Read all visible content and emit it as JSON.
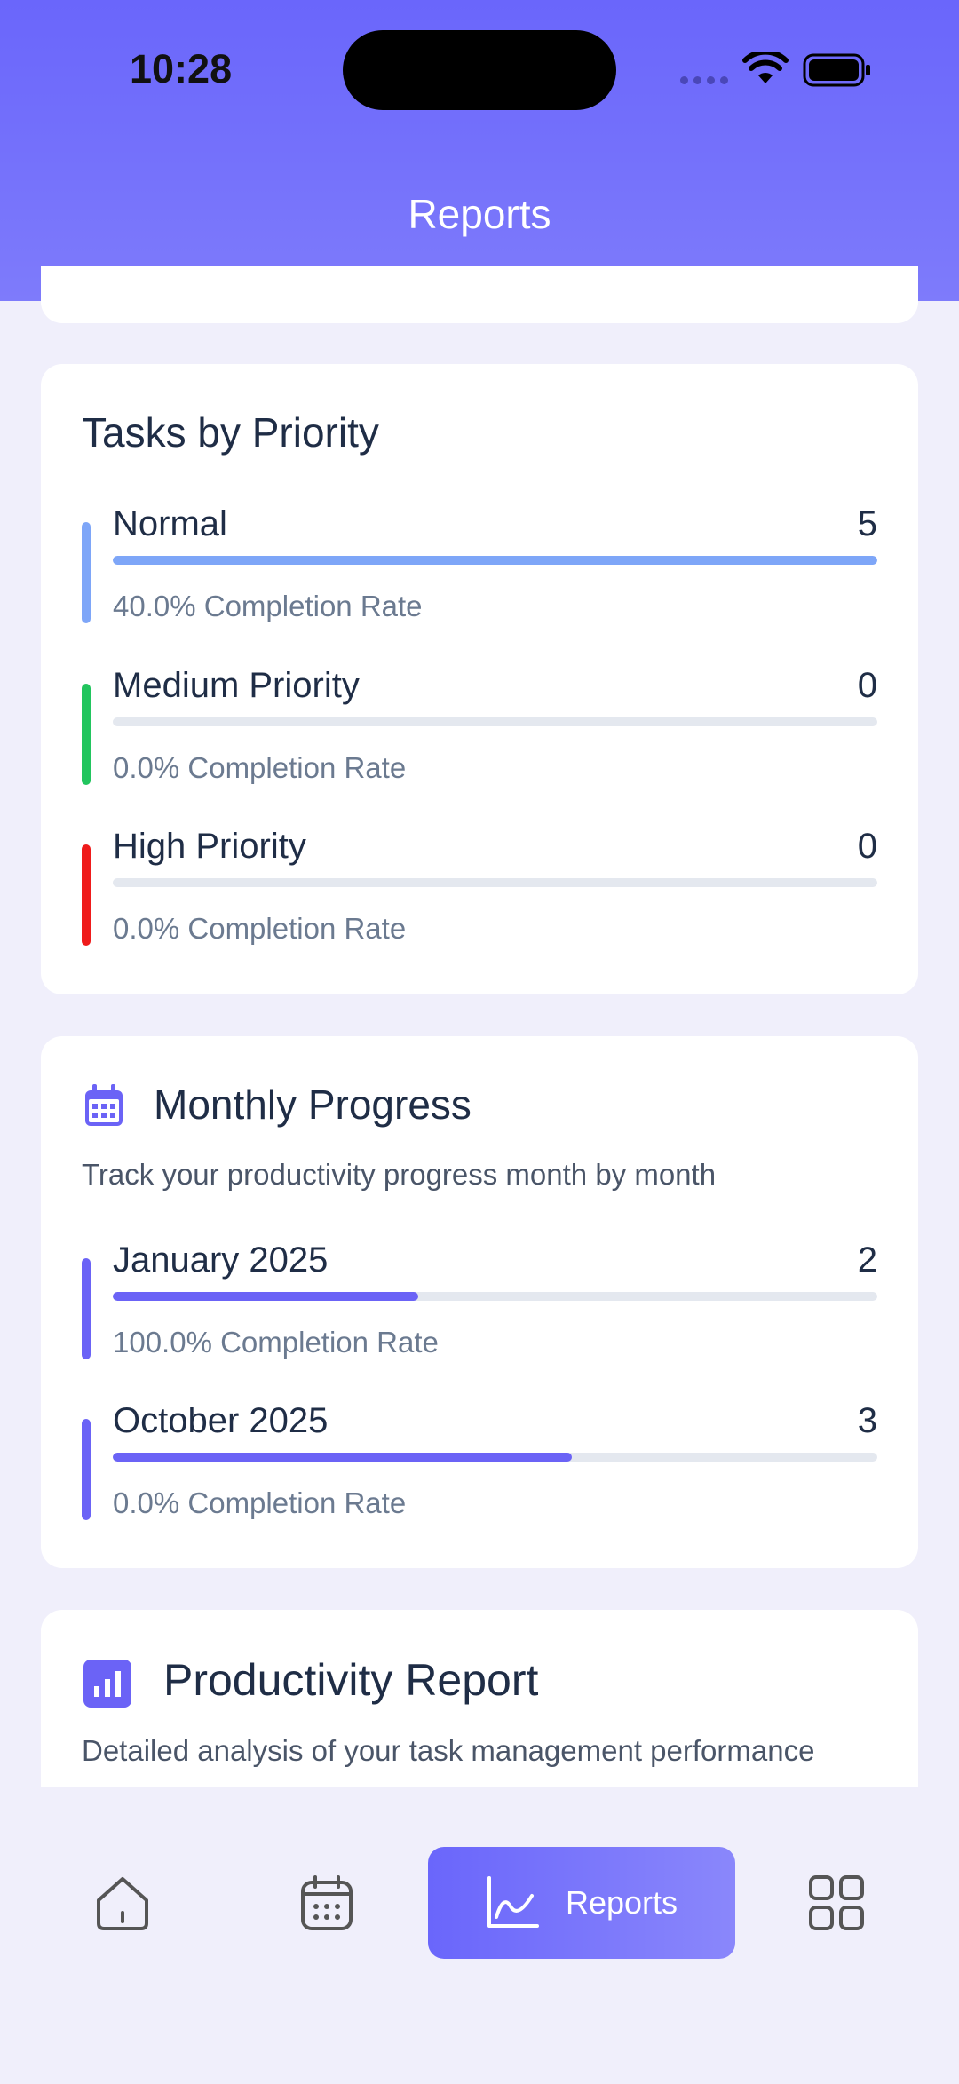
{
  "status_bar": {
    "time": "10:28"
  },
  "header": {
    "title": "Reports"
  },
  "tasks_by_priority": {
    "title": "Tasks by Priority",
    "items": [
      {
        "label": "Normal",
        "count": "5",
        "rate_text": "40.0% Completion Rate",
        "bar_fill": 1.0,
        "bar_color": "#7ea6f8",
        "accent_color": "#7ea6f8"
      },
      {
        "label": "Medium Priority",
        "count": "0",
        "rate_text": "0.0% Completion Rate",
        "bar_fill": 0.0,
        "bar_color": "#22c55e",
        "accent_color": "#22c55e"
      },
      {
        "label": "High Priority",
        "count": "0",
        "rate_text": "0.0% Completion Rate",
        "bar_fill": 0.0,
        "bar_color": "#ef1b1b",
        "accent_color": "#ef1b1b"
      }
    ]
  },
  "monthly_progress": {
    "title": "Monthly Progress",
    "icon": "calendar-icon",
    "subtitle": "Track your productivity progress month by month",
    "items": [
      {
        "label": "January 2025",
        "count": "2",
        "rate_text": "100.0% Completion Rate",
        "bar_fill": 0.4,
        "bar_color": "#6b63f6",
        "accent_color": "#6b63f6"
      },
      {
        "label": "October 2025",
        "count": "3",
        "rate_text": "0.0% Completion Rate",
        "bar_fill": 0.6,
        "bar_color": "#6b63f6",
        "accent_color": "#6b63f6"
      }
    ]
  },
  "productivity_report": {
    "title": "Productivity Report",
    "icon": "bar-chart-icon",
    "subtitle": "Detailed analysis of your task management performance"
  },
  "bottom_nav": {
    "items": [
      {
        "name": "home",
        "icon": "home-icon"
      },
      {
        "name": "calendar",
        "icon": "calendar-icon"
      },
      {
        "name": "reports",
        "icon": "line-chart-icon",
        "label": "Reports",
        "active": true
      },
      {
        "name": "apps",
        "icon": "grid-icon"
      }
    ]
  },
  "colors": {
    "accent": "#6a66fb",
    "background": "#f0effb"
  }
}
